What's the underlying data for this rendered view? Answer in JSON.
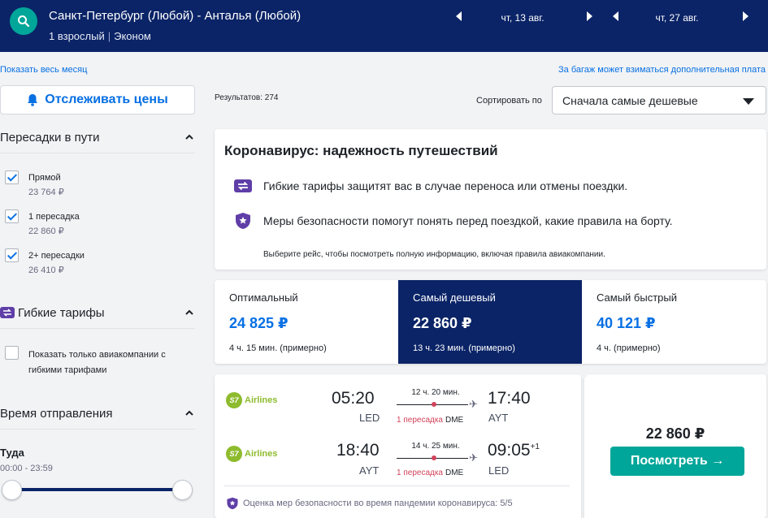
{
  "header": {
    "route": "Санкт-Петербург (Любой) - Анталья (Любой)",
    "passengers": "1 взрослый",
    "cabin": "Эконом",
    "date_out": "чт, 13 авг.",
    "date_back": "чт, 27 авг."
  },
  "links": {
    "show_month": "Показать весь месяц",
    "baggage_note": "За багаж может взиматься дополнительная плата"
  },
  "sidebar": {
    "track_label": "Отслеживать цены",
    "stops": {
      "title": "Пересадки в пути",
      "options": [
        {
          "label": "Прямой",
          "price": "23 764 ₽",
          "checked": true
        },
        {
          "label": "1 пересадка",
          "price": "22 860 ₽",
          "checked": true
        },
        {
          "label": "2+ пересадки",
          "price": "26 410 ₽",
          "checked": true
        }
      ]
    },
    "flex": {
      "title": "Гибкие тарифы",
      "option_label": "Показать только авиакомпании с гибкими тарифами"
    },
    "departure": {
      "title": "Время отправления",
      "leg_label": "Туда",
      "range": "00:00 - 23:59"
    }
  },
  "main": {
    "results": "Результатов: 274",
    "sort_label": "Сортировать по",
    "sort_value": "Сначала самые дешевые",
    "covid": {
      "title": "Коронавирус: надежность путешествий",
      "line1": "Гибкие тарифы защитят вас в случае переноса или отмены поездки.",
      "line2": "Меры безопасности помогут понять перед поездкой, какие правила на борту.",
      "note": "Выберите рейс, чтобы посмотреть полную информацию, включая правила авиакомпании."
    },
    "tabs": [
      {
        "title": "Оптимальный",
        "price": "24 825 ₽",
        "duration": "4 ч. 15 мин. (примерно)"
      },
      {
        "title": "Самый дешевый",
        "price": "22 860 ₽",
        "duration": "13 ч. 23 мин. (примерно)"
      },
      {
        "title": "Самый быстрый",
        "price": "40 121 ₽",
        "duration": "4 ч. (примерно)"
      }
    ],
    "result": {
      "legs": [
        {
          "airline": "Airlines",
          "logo_text": "S7",
          "dep_time": "05:20",
          "dep_code": "LED",
          "duration": "12 ч. 20 мин.",
          "stops": "1 пересадка",
          "via": "DME",
          "arr_time": "17:40",
          "arr_code": "AYT",
          "day_offset": ""
        },
        {
          "airline": "Airlines",
          "logo_text": "S7",
          "dep_time": "18:40",
          "dep_code": "AYT",
          "duration": "14 ч. 25 мин.",
          "stops": "1 пересадка",
          "via": "DME",
          "arr_time": "09:05",
          "arr_code": "LED",
          "day_offset": "+1"
        }
      ],
      "safety": "Оценка мер безопасности во время пандемии коронавируса: 5/5",
      "price": "22 860 ₽",
      "view_label": "Посмотреть →"
    }
  },
  "colors": {
    "header_bg": "#0b2467",
    "accent_teal": "#00a699",
    "link_blue": "#0770e3",
    "stop_red": "#d1435b",
    "s7_green": "#8ebb2e"
  }
}
